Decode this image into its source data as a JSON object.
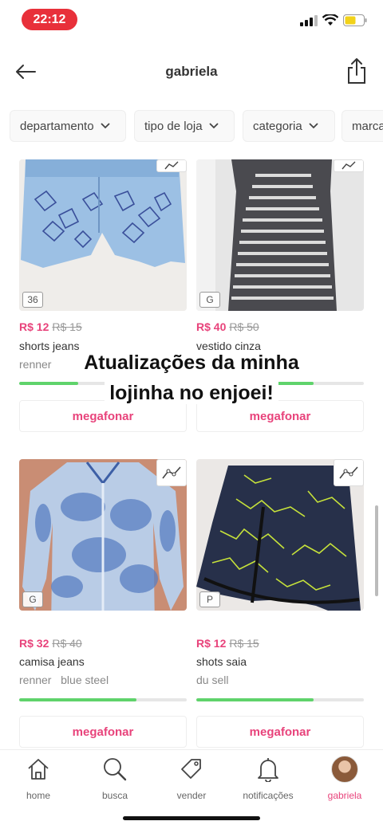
{
  "status_bar": {
    "time": "22:12"
  },
  "header": {
    "title": "gabriela",
    "back_icon": "arrow-left-icon",
    "share_icon": "share-icon"
  },
  "filters": [
    {
      "label": "departamento"
    },
    {
      "label": "tipo de loja"
    },
    {
      "label": "categoria"
    },
    {
      "label": "marca"
    }
  ],
  "products": [
    {
      "size": "36",
      "price": "R$ 12",
      "old_price": "R$ 15",
      "title": "shorts jeans",
      "brands": "renner",
      "progress": 0.35,
      "action": "megafonar"
    },
    {
      "size": "G",
      "price": "R$ 40",
      "old_price": "R$ 50",
      "title": "vestido cinza",
      "brands": "",
      "progress": 0.7,
      "action": "megafonar"
    },
    {
      "size": "G",
      "price": "R$ 32",
      "old_price": "R$ 40",
      "title": "camisa jeans",
      "brands": "renner   blue steel",
      "progress": 0.7,
      "action": "megafonar"
    },
    {
      "size": "P",
      "price": "R$ 12",
      "old_price": "R$ 15",
      "title": "shots saia",
      "brands": "du sell",
      "progress": 0.7,
      "action": "megafonar"
    }
  ],
  "overlay": {
    "line1": "Atualizações da minha",
    "line2": "lojinha no enjoei!"
  },
  "bottom_nav": [
    {
      "label": "home",
      "icon": "home-icon"
    },
    {
      "label": "busca",
      "icon": "search-icon"
    },
    {
      "label": "vender",
      "icon": "tag-icon"
    },
    {
      "label": "notificações",
      "icon": "bell-icon"
    },
    {
      "label": "gabriela",
      "icon": "avatar",
      "active": true
    }
  ],
  "colors": {
    "accent": "#e8437b",
    "progress": "#5fd36b",
    "time_pill": "#e8303a"
  }
}
